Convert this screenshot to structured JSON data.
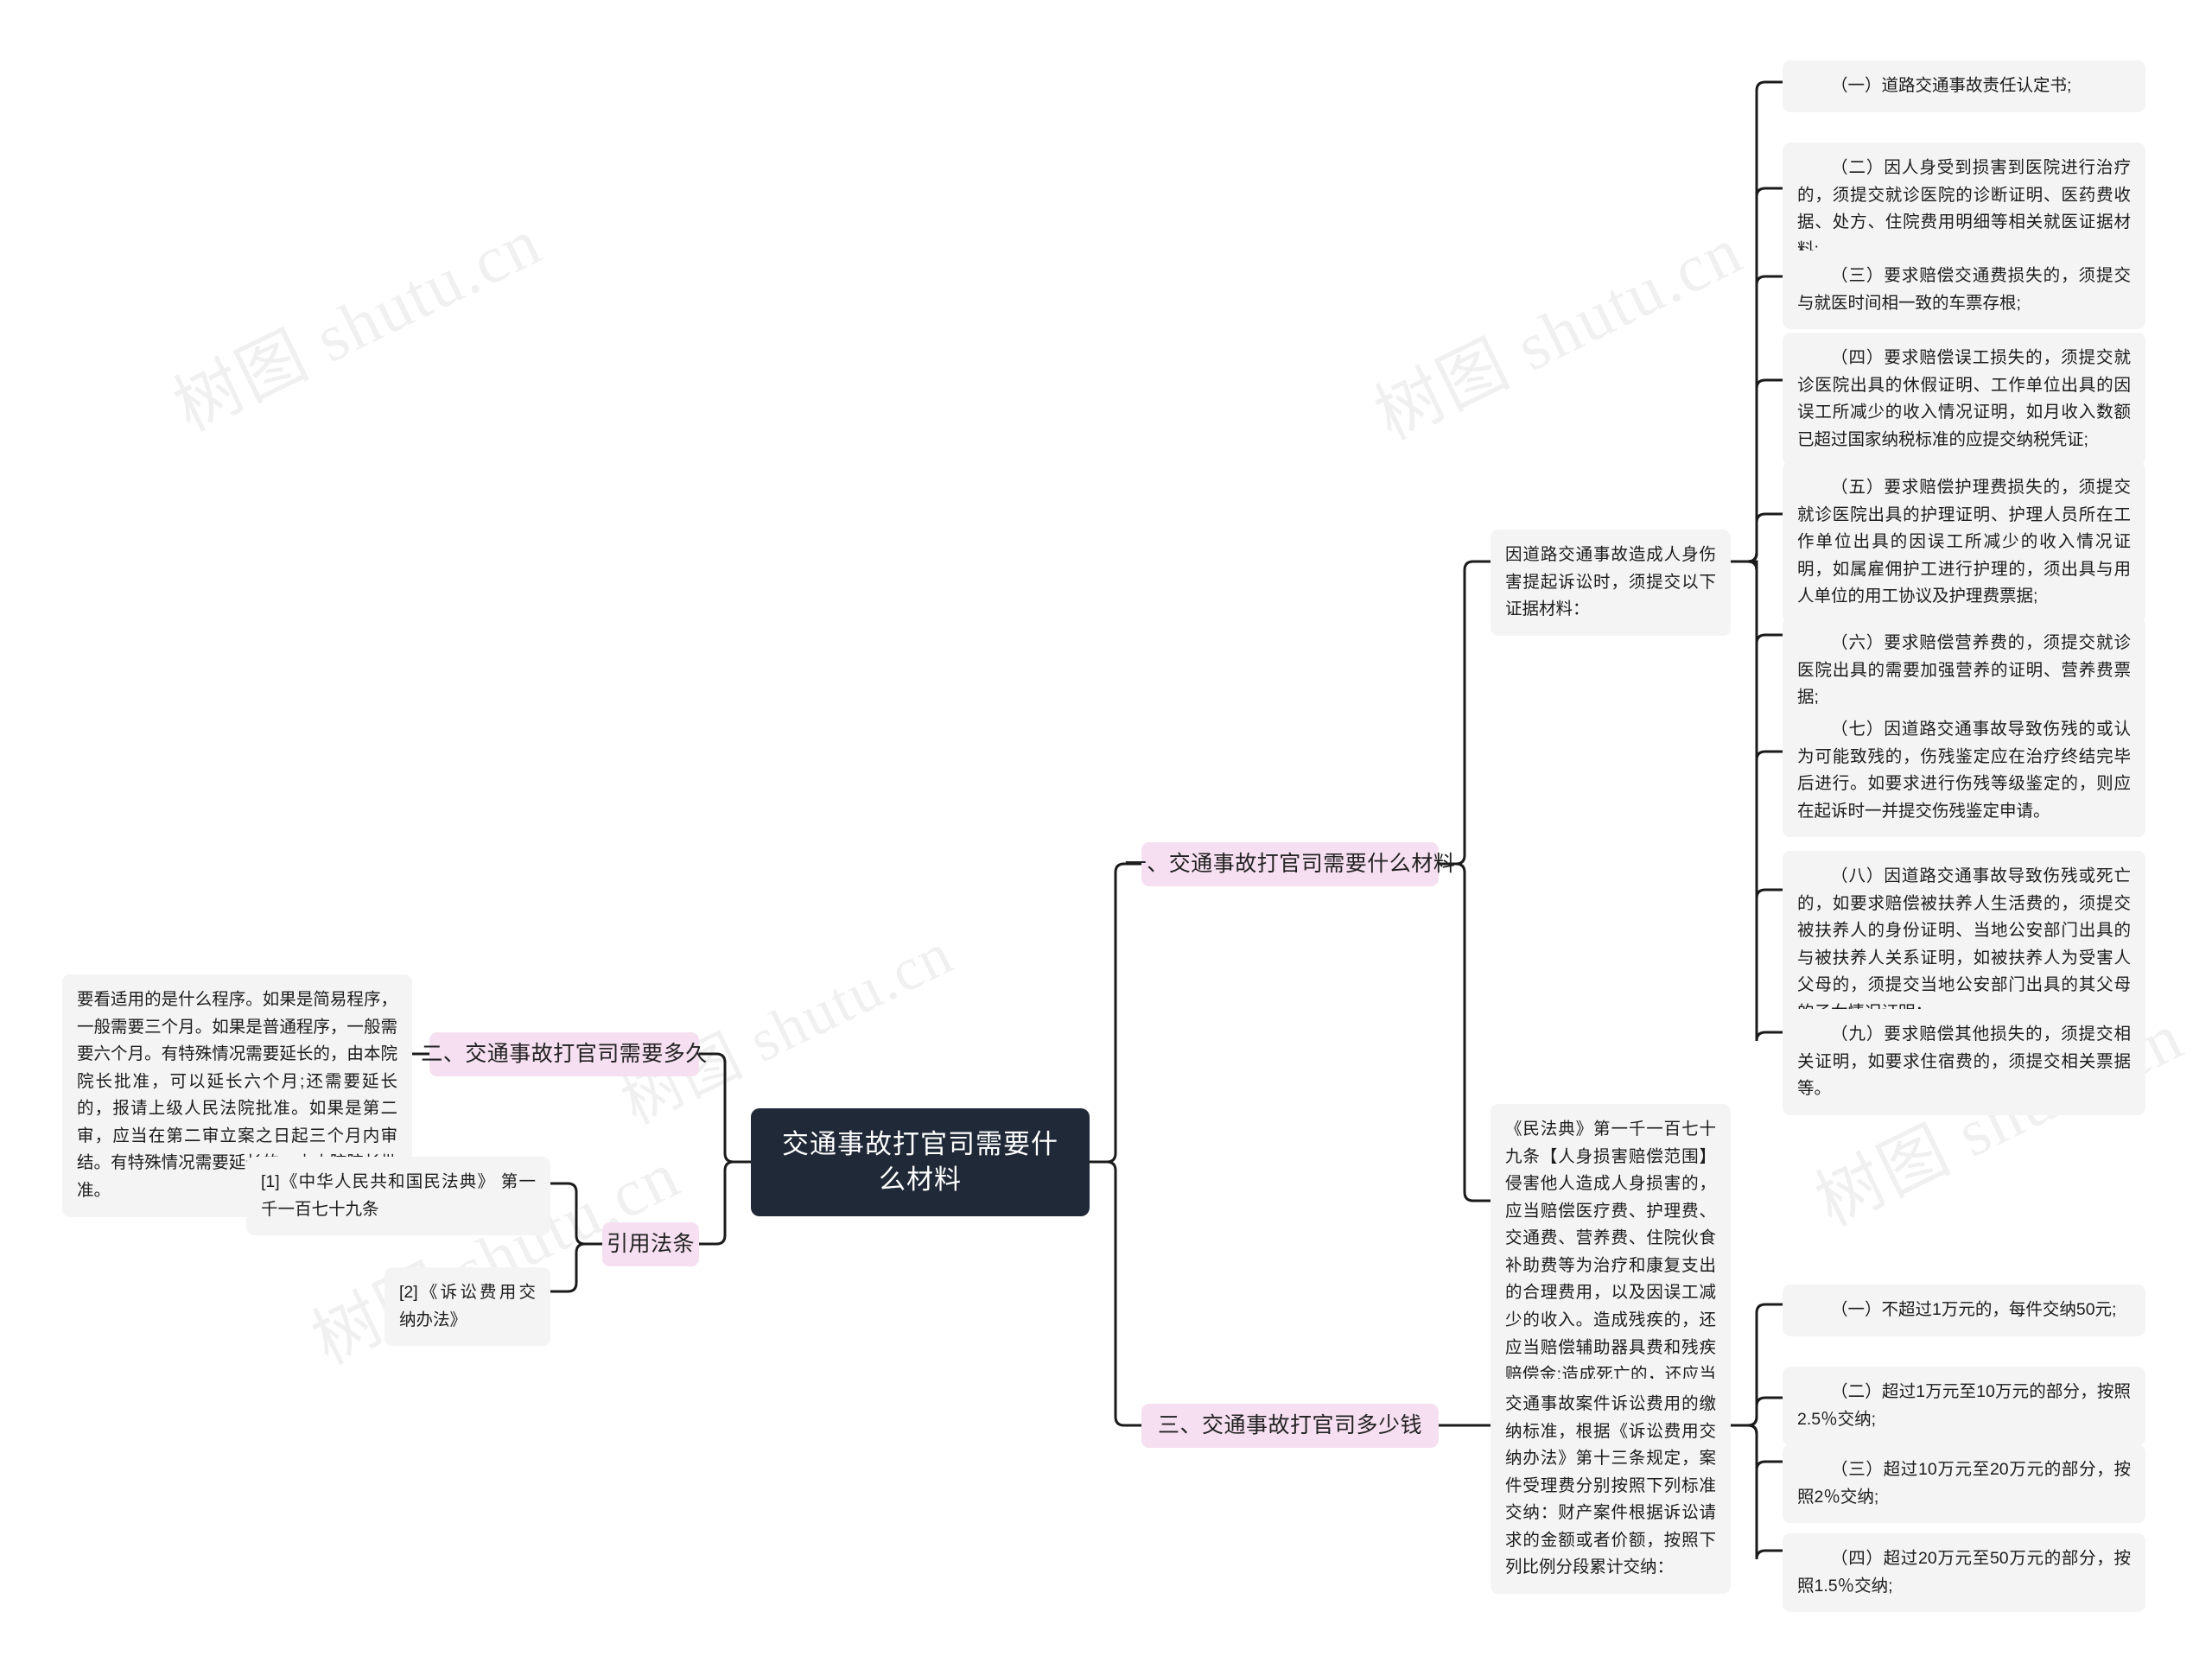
{
  "watermarks": [
    "树图 shutu.cn",
    "树图 shutu.cn",
    "树图 shutu.cn",
    "树图 shutu.cn",
    "树图 shutu.cn"
  ],
  "colors": {
    "root_bg": "#1f2937",
    "root_text": "#ffffff",
    "branch_bg": "#f6dff0",
    "leaf_bg": "#f4f4f5",
    "line": "#1b1b1b",
    "page_bg": "#ffffff"
  },
  "root": {
    "title": "交通事故打官司需要什么材料"
  },
  "branches": {
    "one": {
      "label": "一、交通事故打官司需要什么材料"
    },
    "two": {
      "label": "二、交通事故打官司需要多久"
    },
    "three": {
      "label": "三、交通事故打官司多少钱"
    },
    "citations": {
      "label": "引用法条"
    }
  },
  "evidence": {
    "intro": "因道路交通事故造成人身伤害提起诉讼时，须提交以下证据材料：",
    "items": [
      "（一）道路交通事故责任认定书;",
      "（二）因人身受到损害到医院进行治疗的，须提交就诊医院的诊断证明、医药费收据、处方、住院费用明细等相关就医证据材料;",
      "（三）要求赔偿交通费损失的，须提交与就医时间相一致的车票存根;",
      "（四）要求赔偿误工损失的，须提交就诊医院出具的休假证明、工作单位出具的因误工所减少的收入情况证明，如月收入数额已超过国家纳税标准的应提交纳税凭证;",
      "（五）要求赔偿护理费损失的，须提交就诊医院出具的护理证明、护理人员所在工作单位出具的因误工所减少的收入情况证明，如属雇佣护工进行护理的，须出具与用人单位的用工协议及护理费票据;",
      "（六）要求赔偿营养费的，须提交就诊医院出具的需要加强营养的证明、营养费票据;",
      "（七）因道路交通事故导致伤残的或认为可能致残的，伤残鉴定应在治疗终结完毕后进行。如要求进行伤残等级鉴定的，则应在起诉时一并提交伤残鉴定申请。",
      "（八）因道路交通事故导致伤残或死亡的，如要求赔偿被扶养人生活费的，须提交被扶养人的身份证明、当地公安部门出具的与被扶养人关系证明，如被扶养人为受害人父母的，须提交当地公安部门出具的其父母的子女情况证明；",
      "（九）要求赔偿其他损失的，须提交相关证明，如要求住宿费的，须提交相关票据等。"
    ]
  },
  "duration": {
    "text": "要看适用的是什么程序。如果是简易程序，一般需要三个月。如果是普通程序，一般需要六个月。有特殊情况需要延长的，由本院院长批准，可以延长六个月;还需要延长的，报请上级人民法院批准。如果是第二审，应当在第二审立案之日起三个月内审结。有特殊情况需要延长的，由本院院长批准。"
  },
  "civil_code": {
    "text": "《民法典》第一千一百七十九条【人身损害赔偿范围】侵害他人造成人身损害的，应当赔偿医疗费、护理费、交通费、营养费、住院伙食补助费等为治疗和康复支出的合理费用，以及因误工减少的收入。造成残疾的，还应当赔偿辅助器具费和残疾赔偿金;造成死亡的，还应当赔偿丧葬费和死亡赔偿金。"
  },
  "fees": {
    "intro": "交通事故案件诉讼费用的缴纳标准，根据《诉讼费用交纳办法》第十三条规定，案件受理费分别按照下列标准交纳：财产案件根据诉讼请求的金额或者价额，按照下列比例分段累计交纳：",
    "tiers": [
      "（一）不超过1万元的，每件交纳50元;",
      "（二）超过1万元至10万元的部分，按照2.5％交纳;",
      "（三）超过10万元至20万元的部分，按照2％交纳;",
      "（四）超过20万元至50万元的部分，按照1.5％交纳;"
    ]
  },
  "citations": {
    "items": [
      "[1]《中华人民共和国民法典》 第一千一百七十九条",
      "[2]《诉讼费用交纳办法》"
    ]
  }
}
